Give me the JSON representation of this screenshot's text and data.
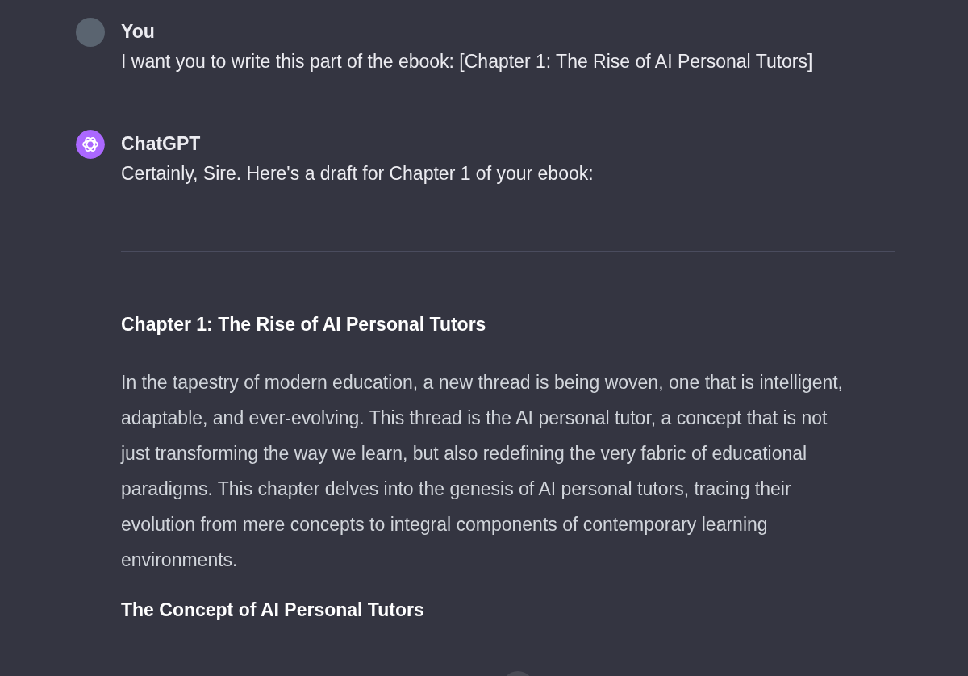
{
  "messages": [
    {
      "author": "You",
      "kind": "photo",
      "text": "I want you to write this part of the ebook: [Chapter 1: The Rise of AI Personal Tutors]"
    },
    {
      "author": "ChatGPT",
      "kind": "logo",
      "text": "Certainly, Sire. Here's a draft for Chapter 1 of your ebook:",
      "blocks": [
        {
          "kind": "rule"
        },
        {
          "kind": "heading",
          "text": "Chapter 1: The Rise of AI Personal Tutors"
        },
        {
          "kind": "paragraph",
          "text": "In the tapestry of modern education, a new thread is being woven, one that is intelligent, adaptable, and ever-evolving. This thread is the AI personal tutor, a concept that is not just transforming the way we learn, but also redefining the very fabric of educational paradigms. This chapter delves into the genesis of AI personal tutors, tracing their evolution from mere concepts to integral components of contemporary learning environments."
        },
        {
          "kind": "heading",
          "text": "The Concept of AI Personal Tutors"
        }
      ]
    }
  ]
}
